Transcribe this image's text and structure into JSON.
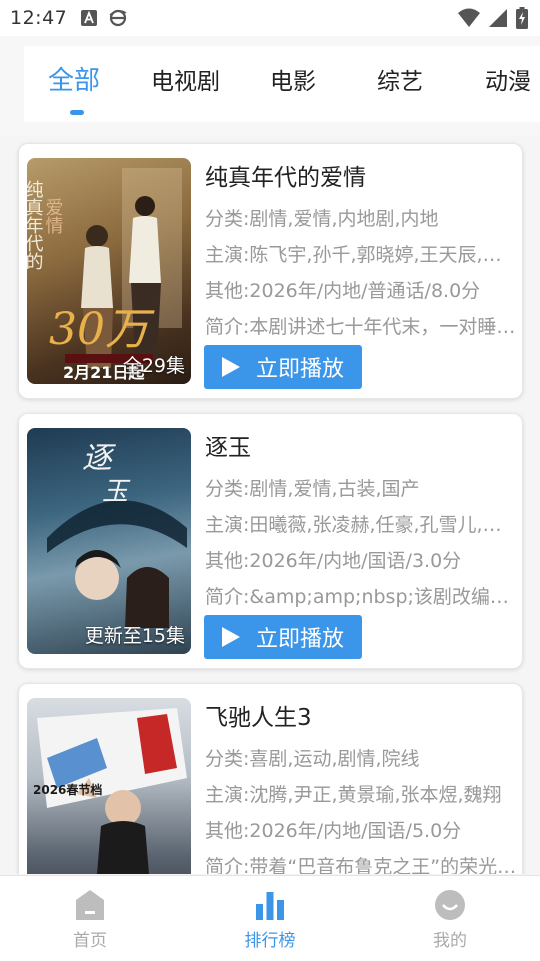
{
  "status_bar": {
    "time": "12:47"
  },
  "tabs": [
    {
      "label": "全部",
      "active": true
    },
    {
      "label": "电视剧",
      "active": false
    },
    {
      "label": "电影",
      "active": false
    },
    {
      "label": "综艺",
      "active": false
    },
    {
      "label": "动漫",
      "active": false
    }
  ],
  "cards": [
    {
      "title": "纯真年代的爱情",
      "category": "分类:剧情,爱情,内地剧,内地",
      "cast": "主演:陈飞宇,孙千,郭晓婷,王天辰,刘怡潼",
      "other": "其他:2026年/内地/普通话/8.0分",
      "intro": "简介:本剧讲述七十年代末，一对睡在上下铺的兄弟",
      "badge": "全29集",
      "play_label": "立即播放",
      "poster_text": {
        "vertical_title": "纯真年代的爱情",
        "big_number": "30万",
        "date": "2月21日起"
      }
    },
    {
      "title": "逐玉",
      "category": "分类:剧情,爱情,古装,国产",
      "cast": "主演:田曦薇,张凌赫,任豪,孔雪儿,杨雨潼",
      "other": "其他:2026年/内地/国语/3.0分",
      "intro": "简介:&amp;amp;nbsp;该剧改编自同名小说",
      "badge": "更新至15集",
      "play_label": "立即播放",
      "poster_text": {
        "logo": "逐玉"
      }
    },
    {
      "title": "飞驰人生3",
      "category": "分类:喜剧,运动,剧情,院线",
      "cast": "主演:沈腾,尹正,黄景瑜,张本煜,魏翔",
      "other": "其他:2026年/内地/国语/5.0分",
      "intro": "简介:带着“巴音布鲁克之王”的荣光重返赛场",
      "badge": "",
      "play_label": "立即播放",
      "poster_text": {
        "tag": "2026春节档"
      }
    }
  ],
  "bottom_nav": [
    {
      "label": "首页",
      "icon": "home-icon",
      "active": false
    },
    {
      "label": "排行榜",
      "icon": "chart-icon",
      "active": true
    },
    {
      "label": "我的",
      "icon": "profile-icon",
      "active": false
    }
  ],
  "colors": {
    "accent": "#3b96ea",
    "meta_text": "#999999",
    "inactive": "#aaaaaa"
  }
}
